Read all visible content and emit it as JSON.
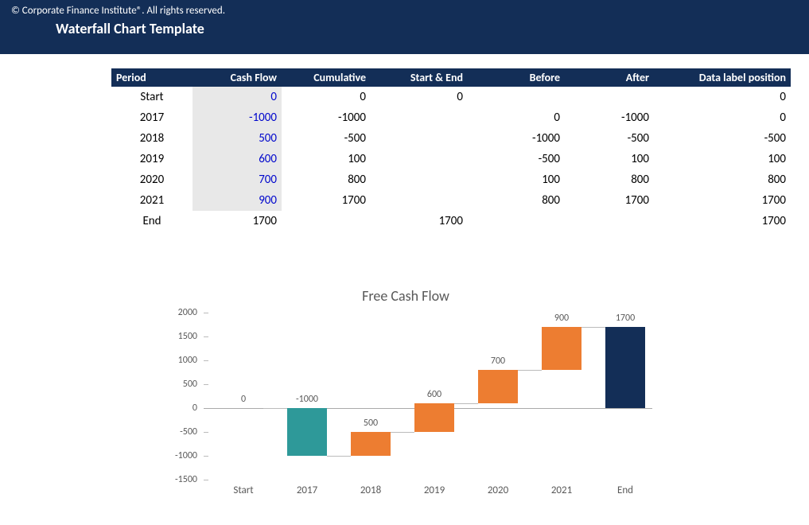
{
  "banner": {
    "copyright": "© Corporate Finance Institute®. All rights reserved.",
    "title": "Waterfall Chart Template"
  },
  "table": {
    "headers": {
      "period": "Period",
      "cash": "Cash Flow",
      "cum": "Cumulative",
      "se": "Start & End",
      "before": "Before",
      "after": "After",
      "pos": "Data label position"
    },
    "rows": [
      {
        "period": "Start",
        "cash": "0",
        "cash_black": false,
        "cum": "0",
        "se": "0",
        "before": "",
        "after": "",
        "pos": "0"
      },
      {
        "period": "2017",
        "cash": "-1000",
        "cash_black": false,
        "cum": "-1000",
        "se": "",
        "before": "0",
        "after": "-1000",
        "pos": "0"
      },
      {
        "period": "2018",
        "cash": "500",
        "cash_black": false,
        "cum": "-500",
        "se": "",
        "before": "-1000",
        "after": "-500",
        "pos": "-500"
      },
      {
        "period": "2019",
        "cash": "600",
        "cash_black": false,
        "cum": "100",
        "se": "",
        "before": "-500",
        "after": "100",
        "pos": "100"
      },
      {
        "period": "2020",
        "cash": "700",
        "cash_black": false,
        "cum": "800",
        "se": "",
        "before": "100",
        "after": "800",
        "pos": "800"
      },
      {
        "period": "2021",
        "cash": "900",
        "cash_black": false,
        "cum": "1700",
        "se": "",
        "before": "800",
        "after": "1700",
        "pos": "1700"
      },
      {
        "period": "End",
        "cash": "1700",
        "cash_black": true,
        "cum": "",
        "se": "1700",
        "before": "",
        "after": "",
        "pos": "1700"
      }
    ]
  },
  "chart_data": {
    "type": "bar",
    "title": "Free Cash Flow",
    "ylim": [
      -1500,
      2000
    ],
    "yticks": [
      -1500,
      -1000,
      -500,
      0,
      500,
      1000,
      1500,
      2000
    ],
    "categories": [
      "Start",
      "2017",
      "2018",
      "2019",
      "2020",
      "2021",
      "End"
    ],
    "series": [
      {
        "name": "Start & End",
        "role": "total",
        "values": [
          0,
          null,
          null,
          null,
          null,
          null,
          1700
        ]
      },
      {
        "name": "Before",
        "role": "base",
        "values": [
          null,
          0,
          -1000,
          -500,
          100,
          800,
          null
        ]
      },
      {
        "name": "After",
        "role": "end",
        "values": [
          null,
          -1000,
          -500,
          100,
          800,
          1700,
          null
        ]
      },
      {
        "name": "Cash Flow",
        "role": "delta",
        "values": [
          0,
          -1000,
          500,
          600,
          700,
          900,
          1700
        ]
      }
    ],
    "data_labels": [
      "0",
      "-1000",
      "500",
      "600",
      "700",
      "900",
      "1700"
    ],
    "label_positions": [
      0,
      0,
      -500,
      100,
      800,
      1700,
      1700
    ]
  }
}
